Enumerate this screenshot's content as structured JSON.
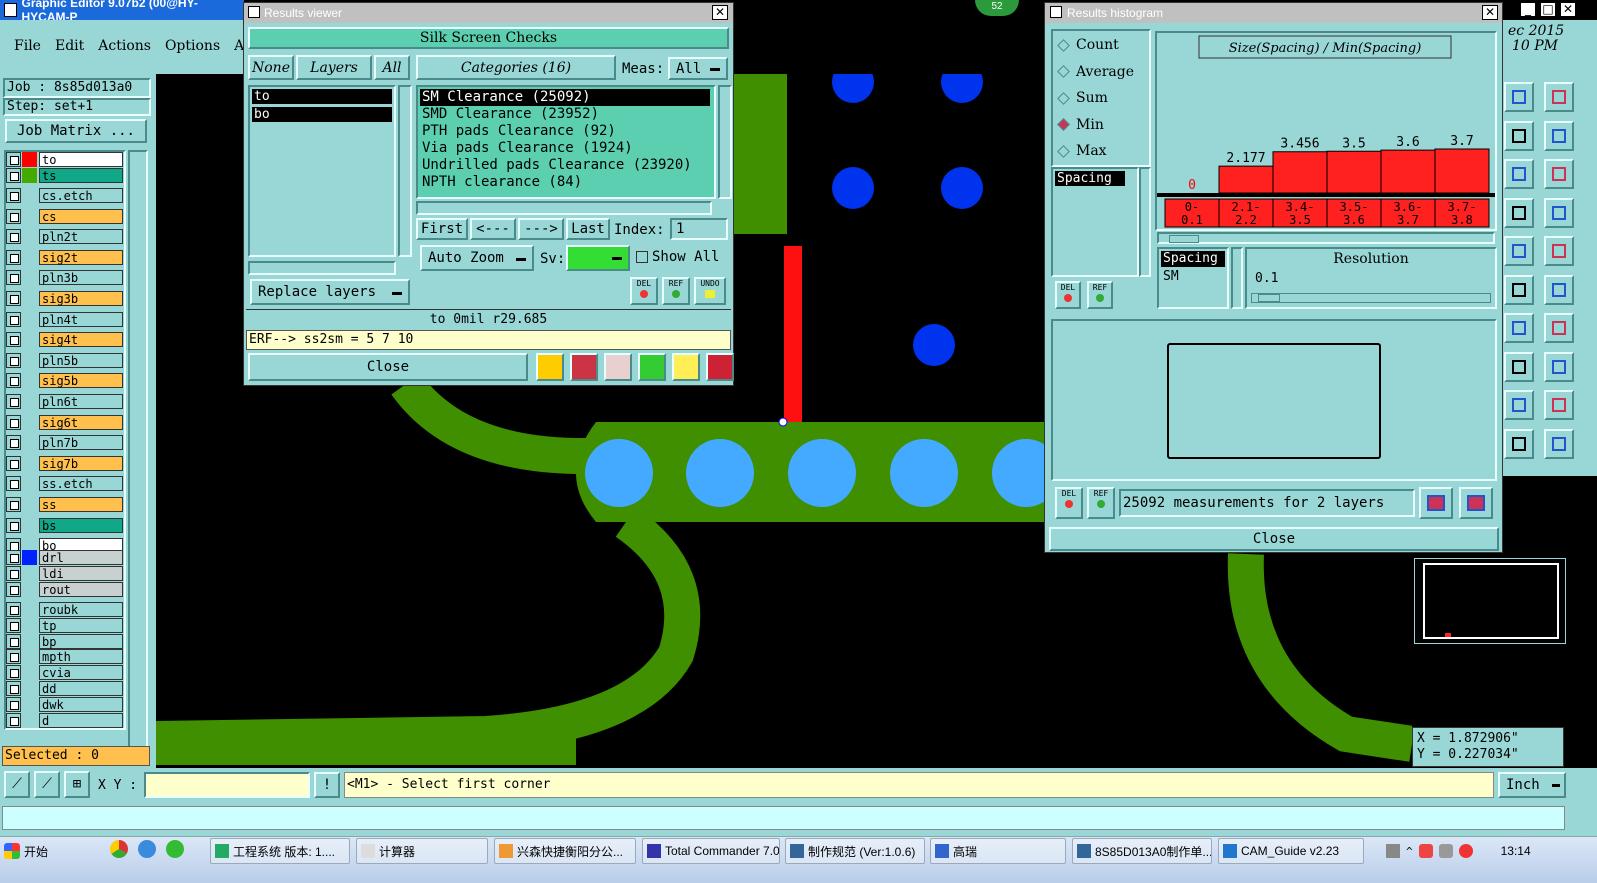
{
  "app": {
    "title": "Graphic Editor 9.07b2 (00@HY-HYCAM-P",
    "menus": [
      "File",
      "Edit",
      "Actions",
      "Options",
      "An"
    ],
    "badge": "52",
    "date_fragment": "ec 2015",
    "time_fragment": "10 PM"
  },
  "left_panel": {
    "job": "Job : 8s85d013a0",
    "step": "Step: set+1",
    "job_matrix": "Job Matrix ...",
    "selected": "Selected : 0",
    "layers": [
      {
        "name": "to",
        "color": "#ffffff",
        "swatch": "#ff0000"
      },
      {
        "name": "ts",
        "color": "#11a88a",
        "swatch": "#44aa00"
      },
      {
        "name": "cs.etch",
        "color": "#99d6d6",
        "swatch": "#99d6d6"
      },
      {
        "name": "cs",
        "color": "#ffc04d",
        "swatch": "#99d6d6"
      },
      {
        "name": "pln2t",
        "color": "#99d6d6",
        "swatch": "#99d6d6"
      },
      {
        "name": "sig2t",
        "color": "#ffc04d",
        "swatch": "#99d6d6"
      },
      {
        "name": "pln3b",
        "color": "#99d6d6",
        "swatch": "#99d6d6"
      },
      {
        "name": "sig3b",
        "color": "#ffc04d",
        "swatch": "#99d6d6"
      },
      {
        "name": "pln4t",
        "color": "#99d6d6",
        "swatch": "#99d6d6"
      },
      {
        "name": "sig4t",
        "color": "#ffc04d",
        "swatch": "#99d6d6"
      },
      {
        "name": "pln5b",
        "color": "#99d6d6",
        "swatch": "#99d6d6"
      },
      {
        "name": "sig5b",
        "color": "#ffc04d",
        "swatch": "#99d6d6"
      },
      {
        "name": "pln6t",
        "color": "#99d6d6",
        "swatch": "#99d6d6"
      },
      {
        "name": "sig6t",
        "color": "#ffc04d",
        "swatch": "#99d6d6"
      },
      {
        "name": "pln7b",
        "color": "#99d6d6",
        "swatch": "#99d6d6"
      },
      {
        "name": "sig7b",
        "color": "#ffc04d",
        "swatch": "#99d6d6"
      },
      {
        "name": "ss.etch",
        "color": "#99d6d6",
        "swatch": "#99d6d6"
      },
      {
        "name": "ss",
        "color": "#ffc04d",
        "swatch": "#99d6d6"
      },
      {
        "name": "bs",
        "color": "#11a88a",
        "swatch": "#99d6d6"
      },
      {
        "name": "bo",
        "color": "#ffffff",
        "swatch": "#99d6d6"
      }
    ],
    "layers2": [
      {
        "name": "drl",
        "color": "#c8d0d0",
        "swatch": "#0022ff"
      },
      {
        "name": "ldi",
        "color": "#c8d0d0",
        "swatch": "#99d6d6"
      },
      {
        "name": "rout",
        "color": "#c8d0d0",
        "swatch": "#99d6d6"
      }
    ],
    "layers3": [
      {
        "name": "roubk",
        "color": "#99d6d6",
        "swatch": "#99d6d6"
      },
      {
        "name": "tp",
        "color": "#99d6d6",
        "swatch": "#99d6d6"
      },
      {
        "name": "bp",
        "color": "#99d6d6",
        "swatch": "#99d6d6"
      },
      {
        "name": "mpth",
        "color": "#99d6d6",
        "swatch": "#99d6d6"
      },
      {
        "name": "cvia",
        "color": "#99d6d6",
        "swatch": "#99d6d6"
      },
      {
        "name": "dd",
        "color": "#99d6d6",
        "swatch": "#99d6d6"
      },
      {
        "name": "dwk",
        "color": "#99d6d6",
        "swatch": "#99d6d6"
      },
      {
        "name": "d",
        "color": "#99d6d6",
        "swatch": "#99d6d6"
      }
    ]
  },
  "results_viewer": {
    "title": "Results viewer",
    "header": "Silk Screen Checks",
    "none": "None",
    "layers": "Layers",
    "all": "All",
    "categories_label": "Categories (16)",
    "meas_label": "Meas:",
    "meas_value": "All",
    "layer_list": [
      "to",
      "bo"
    ],
    "categories": [
      "SM Clearance (25092)",
      "SMD Clearance (23952)",
      "PTH pads Clearance (92)",
      "Via pads Clearance (1924)",
      "Undrilled pads Clearance (23920)",
      "NPTH clearance (84)"
    ],
    "first": "First",
    "prev": "<---",
    "next": "--->",
    "last": "Last",
    "index_label": "Index:",
    "index_value": "1",
    "auto_zoom": "Auto Zoom",
    "sv_label": "Sv:",
    "show_all": "Show All",
    "replace_layers": "Replace layers",
    "del": "DEL",
    "ref": "REF",
    "undo": "UNDO",
    "status": "to  0mil  r29.685",
    "erf": "ERF--> ss2sm = 5 7 10",
    "close": "Close"
  },
  "histogram": {
    "title": "Results histogram",
    "stat_options": [
      "Count",
      "Average",
      "Sum",
      "Min",
      "Max"
    ],
    "selected_stat": "Min",
    "spacing_item": "Spacing",
    "chart_title": "Size(Spacing) / Min(Spacing)",
    "spacing_list": [
      "Spacing",
      "SM"
    ],
    "resolution_label": "Resolution",
    "resolution_value": "0.1",
    "measurements": "25092 measurements for 2 layers",
    "del": "DEL",
    "ref": "REF",
    "close": "Close"
  },
  "chart_data": {
    "type": "bar",
    "title": "Size(Spacing) / Min(Spacing)",
    "categories": [
      "0-\n0.1",
      "2.1-\n2.2",
      "3.4-\n3.5",
      "3.5-\n3.6",
      "3.6-\n3.7",
      "3.7-\n3.8"
    ],
    "values": [
      0,
      2.177,
      3.456,
      3.5,
      3.6,
      3.7
    ],
    "labels": [
      "0",
      "2.177",
      "3.456",
      "3.5",
      "3.6",
      "3.7"
    ],
    "bar_color": "#ff2020",
    "ylim": [
      0,
      3.7
    ]
  },
  "bottom": {
    "xy_label": "X Y :",
    "prompt": "<M1> - Select first corner",
    "unit": "Inch",
    "x_coord": "X = 1.872906\"",
    "y_coord": "Y = 0.227034\""
  },
  "taskbar": {
    "start": "开始",
    "items": [
      "工程系统  版本: 1....",
      "计算器",
      "兴森快捷衡阳分公...",
      "Total Commander 7.0...",
      "制作规范 (Ver:1.0.6)",
      "高瑞",
      "8S85D013A0制作单....",
      "CAM_Guide v2.23"
    ],
    "clock": "13:14"
  }
}
